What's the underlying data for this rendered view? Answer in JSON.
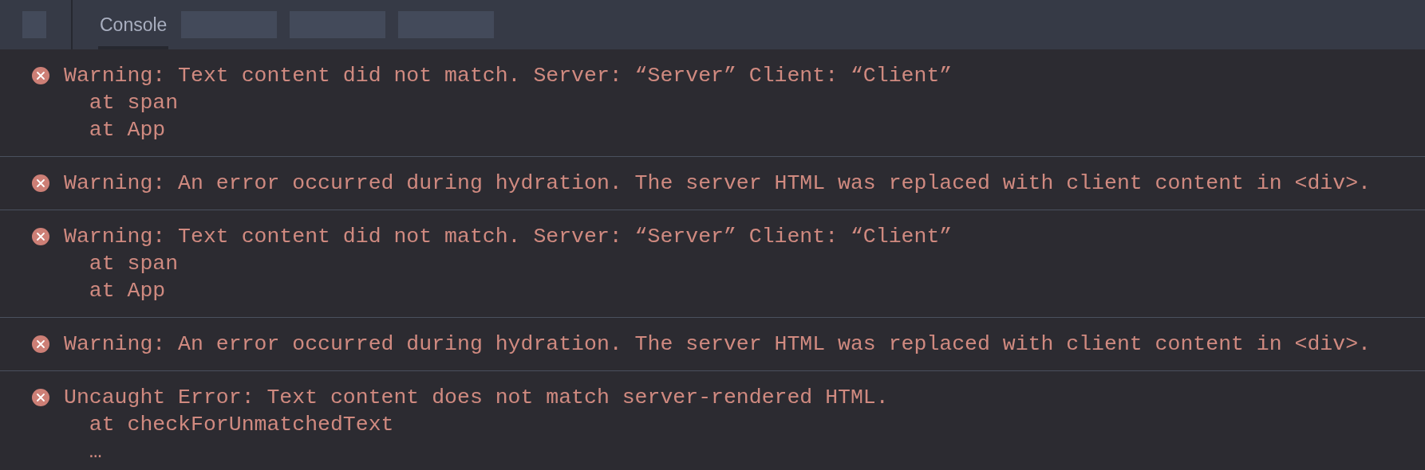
{
  "tabs": [
    {
      "label": "Console",
      "selected": true
    }
  ],
  "console": {
    "entries": [
      {
        "kind": "error",
        "message": "Warning: Text content did not match. Server: “Server” Client: “Client”",
        "stack": [
          "at span",
          "at App"
        ]
      },
      {
        "kind": "error",
        "message": "Warning: An error occurred during hydration. The server HTML was replaced with client content in <div>."
      },
      {
        "kind": "error",
        "message": "Warning: Text content did not match. Server: “Server” Client: “Client”",
        "stack": [
          "at span",
          "at App"
        ]
      },
      {
        "kind": "error",
        "message": "Warning: An error occurred during hydration. The server HTML was replaced with client content in <div>."
      },
      {
        "kind": "error",
        "message": "Uncaught Error: Text content does not match server-rendered HTML.",
        "stack": [
          "at checkForUnmatchedText",
          "…"
        ]
      }
    ]
  }
}
